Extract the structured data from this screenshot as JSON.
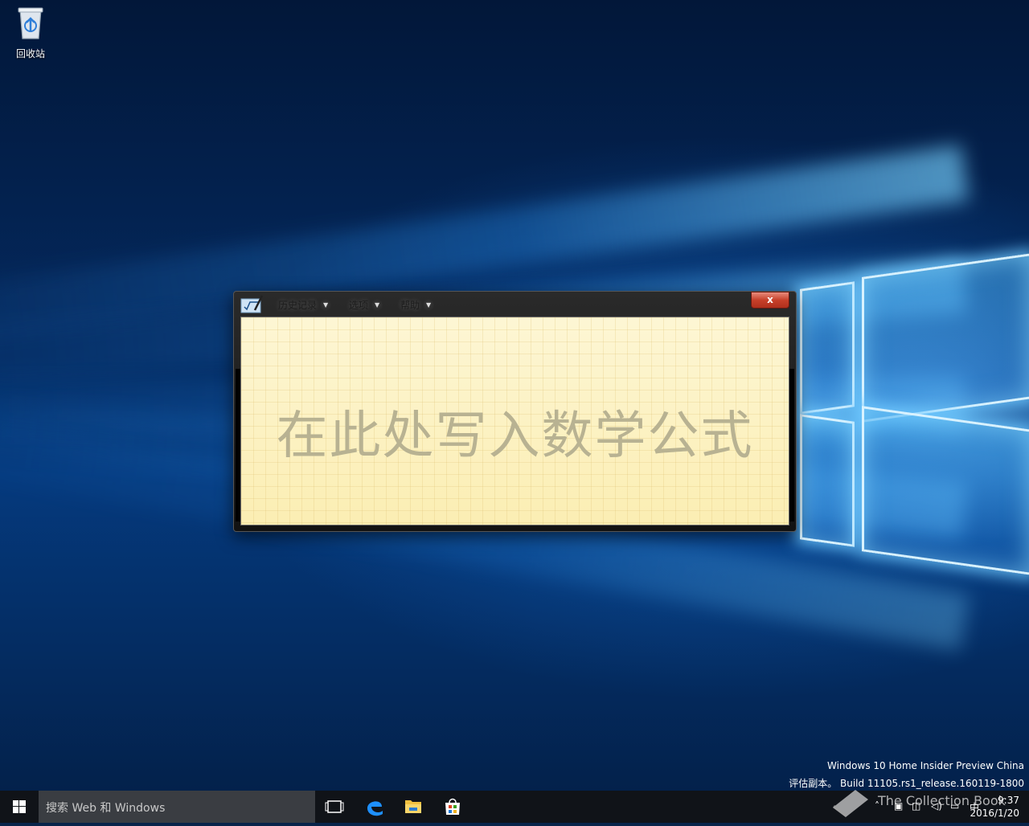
{
  "desktop": {
    "recycle_bin_label": "回收站"
  },
  "math_input_panel": {
    "menu": [
      "历史记录",
      "选项",
      "帮助"
    ],
    "close_label": "x",
    "hint": "在此处写入数学公式"
  },
  "watermark": {
    "line1": "Windows 10 Home Insider Preview China",
    "line2": "评估副本。 Build 11105.rs1_release.160119-1800"
  },
  "taskbar": {
    "search_placeholder": "搜索 Web 和 Windows",
    "pinned": [
      "task-view",
      "edge",
      "file-explorer",
      "store"
    ],
    "tray": {
      "ime": "中",
      "time": "9:37",
      "date": "2016/1/20"
    }
  },
  "overlay_text": "The Collection Book",
  "colors": {
    "taskbar_bg": "#101318",
    "pad_bg": "#fdf3c3",
    "close_red": "#c7402a"
  }
}
